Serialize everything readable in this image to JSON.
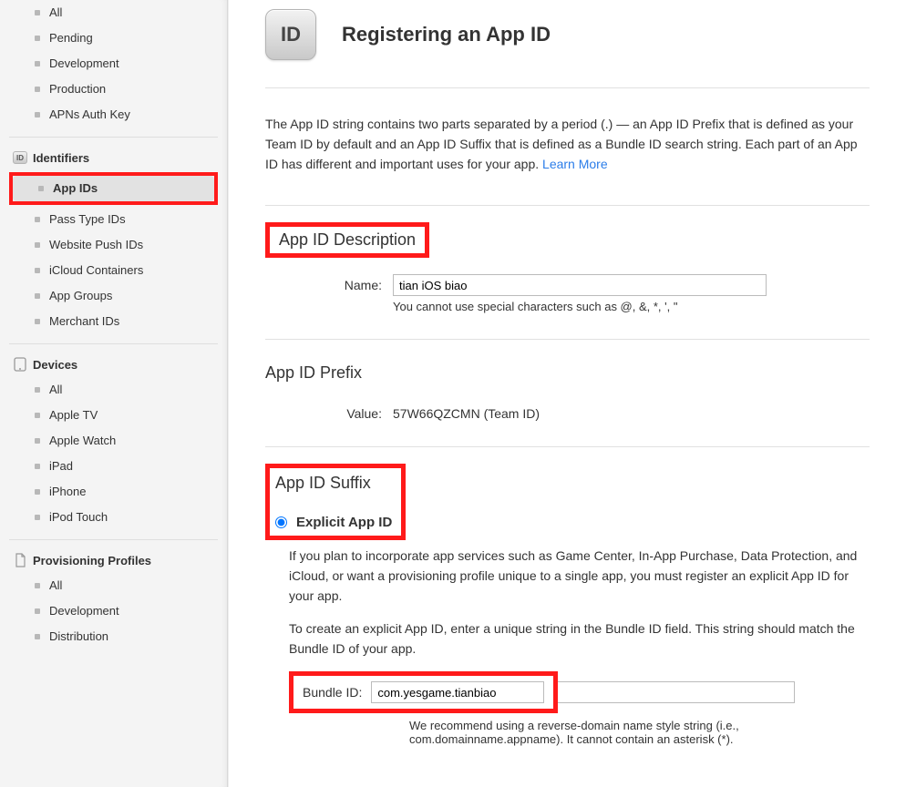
{
  "sidebar": {
    "certificates": {
      "items": [
        "All",
        "Pending",
        "Development",
        "Production",
        "APNs Auth Key"
      ]
    },
    "identifiers": {
      "heading": "Identifiers",
      "items": [
        "App IDs",
        "Pass Type IDs",
        "Website Push IDs",
        "iCloud Containers",
        "App Groups",
        "Merchant IDs"
      ],
      "selected_index": 0
    },
    "devices": {
      "heading": "Devices",
      "items": [
        "All",
        "Apple TV",
        "Apple Watch",
        "iPad",
        "iPhone",
        "iPod Touch"
      ]
    },
    "provisioning": {
      "heading": "Provisioning Profiles",
      "items": [
        "All",
        "Development",
        "Distribution"
      ]
    }
  },
  "main": {
    "badge_text": "ID",
    "title": "Registering an App ID",
    "intro_text": "The App ID string contains two parts separated by a period (.) — an App ID Prefix that is defined as your Team ID by default and an App ID Suffix that is defined as a Bundle ID search string. Each part of an App ID has different and important uses for your app. ",
    "learn_more": "Learn More",
    "desc_section": {
      "title": "App ID Description",
      "name_label": "Name:",
      "name_value": "tian iOS biao",
      "name_hint": "You cannot use special characters such as @, &, *, ', \""
    },
    "prefix_section": {
      "title": "App ID Prefix",
      "value_label": "Value:",
      "value_text": "57W66QZCMN (Team ID)"
    },
    "suffix_section": {
      "title": "App ID Suffix",
      "explicit_label": "Explicit App ID",
      "explicit_checked": true,
      "desc_p1": "If you plan to incorporate app services such as Game Center, In-App Purchase, Data Protection, and iCloud, or want a provisioning profile unique to a single app, you must register an explicit App ID for your app.",
      "desc_p2": "To create an explicit App ID, enter a unique string in the Bundle ID field. This string should match the Bundle ID of your app.",
      "bundle_label": "Bundle ID:",
      "bundle_value": "com.yesgame.tianbiao",
      "bundle_hint": "We recommend using a reverse-domain name style string (i.e., com.domainname.appname). It cannot contain an asterisk (*)."
    }
  }
}
